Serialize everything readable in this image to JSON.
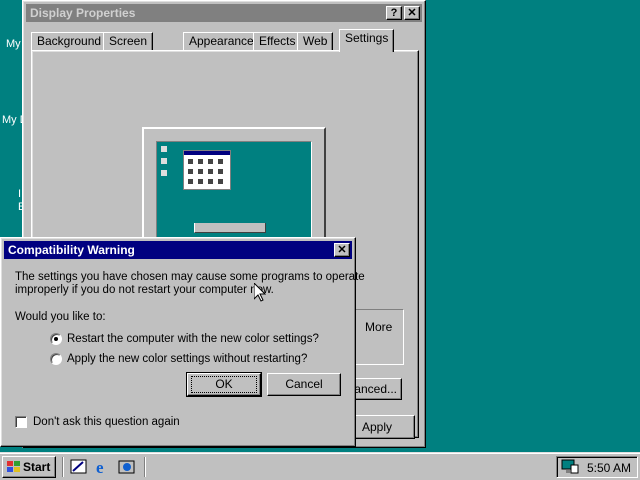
{
  "desktop": {
    "labels": [
      "My",
      "My D",
      "I",
      "E"
    ]
  },
  "display_properties": {
    "title": "Display Properties",
    "help_button": "?",
    "close_button": "✕",
    "tabs": [
      "Background",
      "Screen Saver",
      "Appearance",
      "Effects",
      "Web",
      "Settings"
    ],
    "active_tab": "Settings",
    "more_label": "More",
    "advanced_label": "anced...",
    "apply_label": "Apply"
  },
  "warning": {
    "title": "Compatibility Warning",
    "close_button": "✕",
    "message_line1": "The settings you have chosen may cause some programs to operate",
    "message_line2": "improperly if you do not restart your computer now.",
    "question": "Would you like to:",
    "option_restart": "Restart the computer with the new color settings?",
    "option_apply": "Apply the new color settings without restarting?",
    "selected_option": "restart",
    "ok_label": "OK",
    "cancel_label": "Cancel",
    "dont_ask_label": "Don't ask this question again",
    "dont_ask_checked": false
  },
  "taskbar": {
    "start_label": "Start",
    "quick_launch": [
      "show-desktop-icon",
      "internet-explorer-icon",
      "channels-icon"
    ],
    "clock": "5:50 AM"
  },
  "colors": {
    "desktop": "#008080",
    "active_title": "#000080",
    "inactive_title": "#808080",
    "face": "#c0c0c0"
  }
}
